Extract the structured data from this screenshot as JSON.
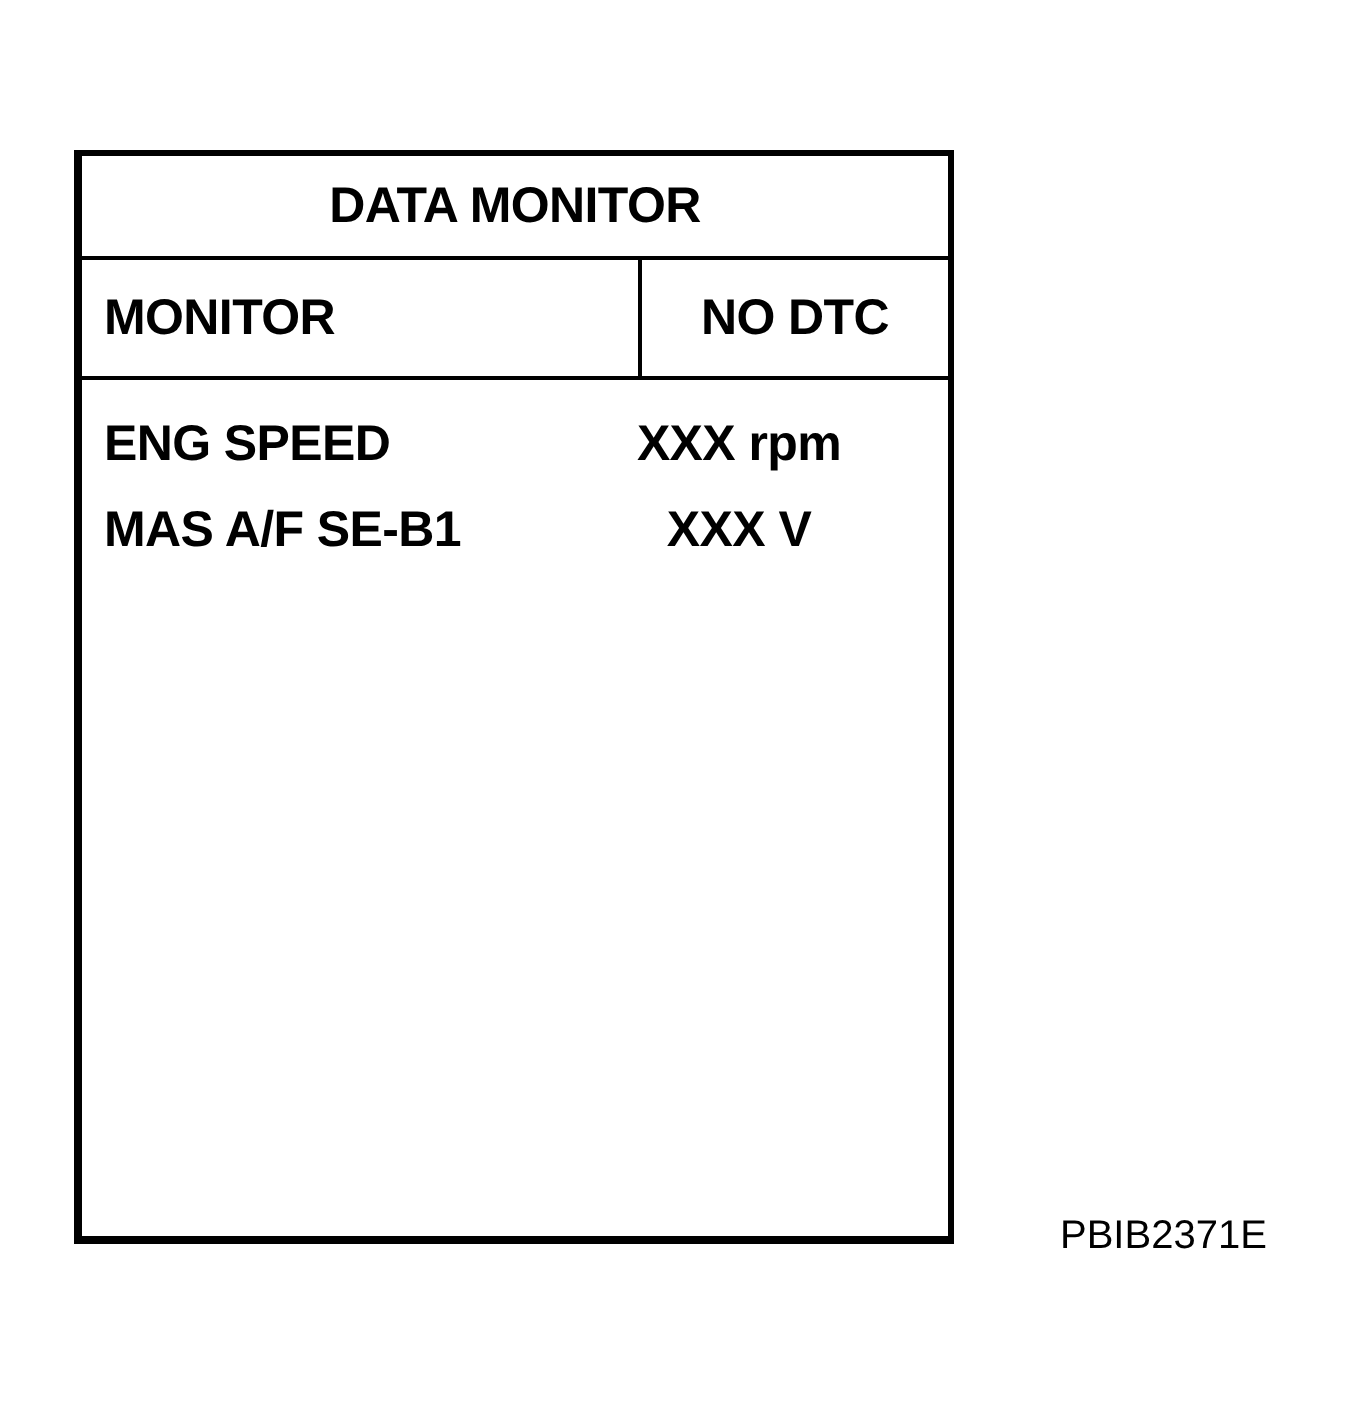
{
  "title": "DATA MONITOR",
  "header": {
    "mode": "MONITOR",
    "status": "NO DTC"
  },
  "items": [
    {
      "name": "ENG SPEED",
      "value": "XXX rpm"
    },
    {
      "name": "MAS A/F SE-B1",
      "value": "XXX V"
    }
  ],
  "figure_code": "PBIB2371E"
}
